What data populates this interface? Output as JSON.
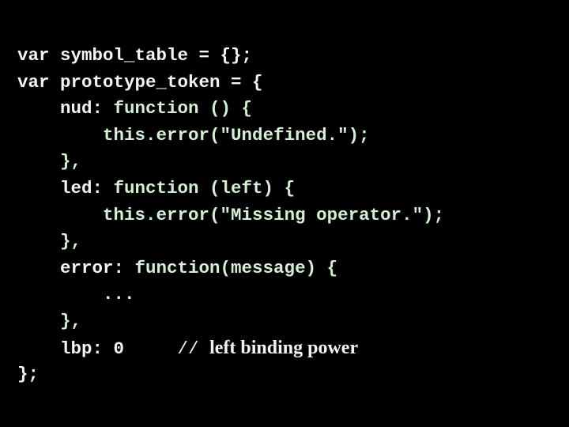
{
  "code": {
    "lines": [
      {
        "indent": "",
        "parts": [
          {
            "t": "var symbol_table = {};",
            "c": "w"
          }
        ]
      },
      {
        "indent": "",
        "parts": [
          {
            "t": "var prototype_token = {",
            "c": "w"
          }
        ]
      },
      {
        "indent": "    ",
        "parts": [
          {
            "t": "nud: ",
            "c": "w"
          },
          {
            "t": "function () {",
            "c": "g"
          }
        ]
      },
      {
        "indent": "        ",
        "parts": [
          {
            "t": "this.error(\"Undefined.\");",
            "c": "g"
          }
        ]
      },
      {
        "indent": "    ",
        "parts": [
          {
            "t": "},",
            "c": "g"
          }
        ]
      },
      {
        "indent": "    ",
        "parts": [
          {
            "t": "led: ",
            "c": "w"
          },
          {
            "t": "function (left) {",
            "c": "g"
          }
        ]
      },
      {
        "indent": "        ",
        "parts": [
          {
            "t": "this.error(\"Missing operator.\");",
            "c": "g"
          }
        ]
      },
      {
        "indent": "    ",
        "parts": [
          {
            "t": "},",
            "c": "g"
          }
        ]
      },
      {
        "indent": "    ",
        "parts": [
          {
            "t": "error: ",
            "c": "w"
          },
          {
            "t": "function(message) {",
            "c": "g"
          }
        ]
      },
      {
        "indent": "        ",
        "parts": [
          {
            "t": "...",
            "c": "w"
          }
        ]
      },
      {
        "indent": "    ",
        "parts": [
          {
            "t": "},",
            "c": "g"
          }
        ]
      },
      {
        "indent": "    ",
        "parts": [
          {
            "t": "lbp: 0",
            "c": "w"
          }
        ]
      },
      {
        "indent": "",
        "parts": [
          {
            "t": "};",
            "c": "w"
          }
        ]
      }
    ],
    "comment_slashes": "//",
    "comment_text": "left binding power"
  }
}
